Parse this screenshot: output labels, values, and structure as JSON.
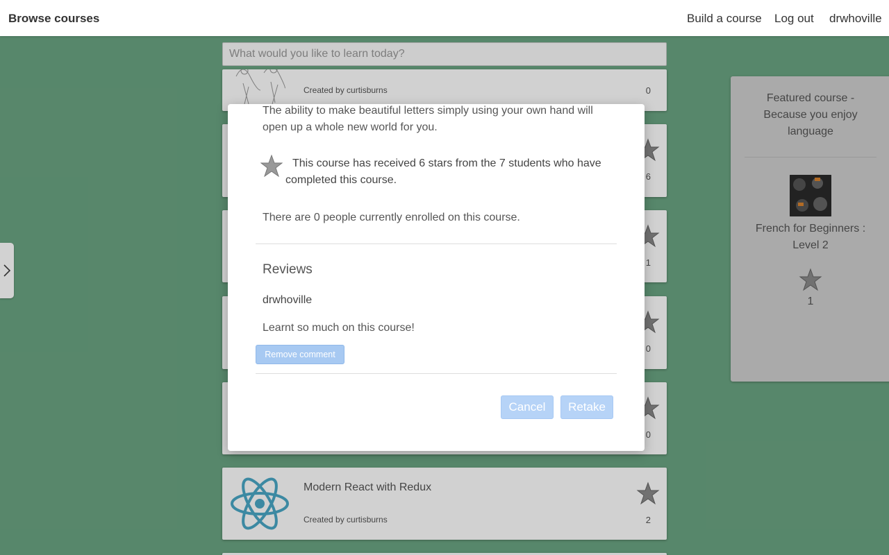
{
  "nav": {
    "brand": "Browse courses",
    "build": "Build a course",
    "logout": "Log out",
    "user": "drwhoville"
  },
  "search": {
    "placeholder": "What would you like to learn today?"
  },
  "courses": [
    {
      "title": "",
      "creator": "Created by curtisburns",
      "count": "0"
    },
    {
      "title": "",
      "creator": "",
      "count": "6"
    },
    {
      "title": "",
      "creator": "",
      "count": "1"
    },
    {
      "title": "",
      "creator": "",
      "count": "0"
    },
    {
      "title": "",
      "creator": "",
      "count": "0"
    },
    {
      "title": "Modern React with Redux",
      "creator": "Created by curtisburns",
      "count": "2"
    }
  ],
  "featured": {
    "heading": "Featured course - Because you enjoy language",
    "title": "French for Beginners : Level 2",
    "stars": "1"
  },
  "modal": {
    "description": "The ability to make beautiful letters simply using your own hand will open up a whole new world for you.",
    "rating_text": "This course has received 6 stars from the 7 students who have completed this course.",
    "enrolled_text": "There are 0 people currently enrolled on this course.",
    "reviews_heading": "Reviews",
    "reviewer": "drwhoville",
    "comment": "Learnt so much on this course!",
    "remove_label": "Remove comment",
    "cancel_label": "Cancel",
    "retake_label": "Retake"
  },
  "colors": {
    "background": "#6ba583",
    "button_primary": "#b6d3f7",
    "react_blue": "#61b5cb"
  },
  "icons": {
    "star": "star-icon",
    "sidebar_toggle": "chevron-right-icon"
  }
}
